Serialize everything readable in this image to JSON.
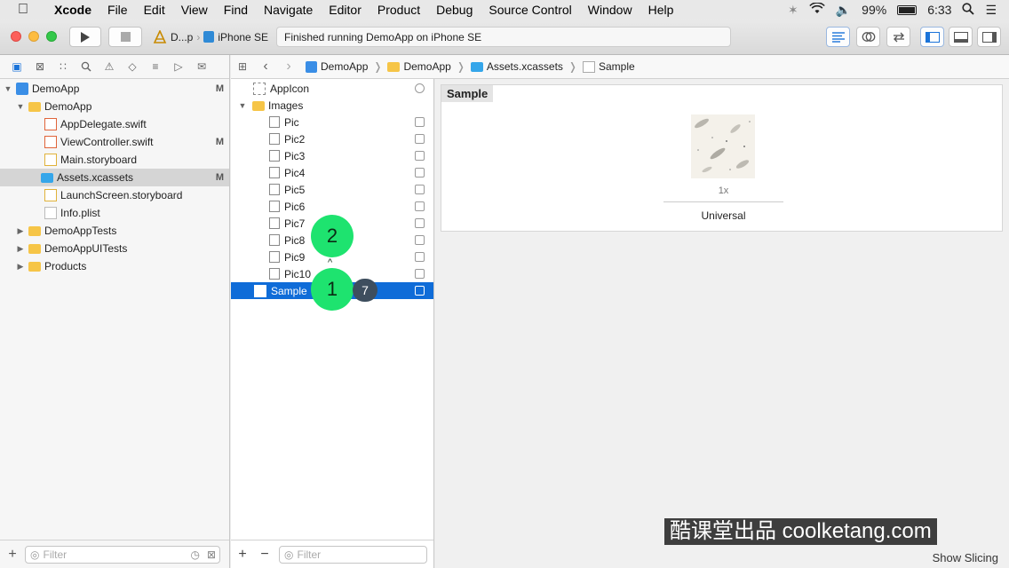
{
  "menubar": {
    "apple": "",
    "items": [
      "Xcode",
      "File",
      "Edit",
      "View",
      "Find",
      "Navigate",
      "Editor",
      "Product",
      "Debug",
      "Source Control",
      "Window",
      "Help"
    ],
    "battery": "99%",
    "time": "6:33"
  },
  "toolbar": {
    "scheme_target": "D...p",
    "scheme_device": "iPhone SE",
    "status_text": "Finished running DemoApp on iPhone SE"
  },
  "navigator": {
    "items": [
      {
        "label": "DemoApp",
        "badge": "M"
      },
      {
        "label": "DemoApp",
        "badge": ""
      },
      {
        "label": "AppDelegate.swift",
        "badge": ""
      },
      {
        "label": "ViewController.swift",
        "badge": "M"
      },
      {
        "label": "Main.storyboard",
        "badge": ""
      },
      {
        "label": "Assets.xcassets",
        "badge": "M"
      },
      {
        "label": "LaunchScreen.storyboard",
        "badge": ""
      },
      {
        "label": "Info.plist",
        "badge": ""
      },
      {
        "label": "DemoAppTests",
        "badge": ""
      },
      {
        "label": "DemoAppUITests",
        "badge": ""
      },
      {
        "label": "Products",
        "badge": ""
      }
    ],
    "filter_placeholder": "Filter"
  },
  "jumpbar": {
    "crumbs": [
      "DemoApp",
      "DemoApp",
      "Assets.xcassets",
      "Sample"
    ]
  },
  "assets": {
    "items": [
      "AppIcon",
      "Images",
      "Pic",
      "Pic2",
      "Pic3",
      "Pic4",
      "Pic5",
      "Pic6",
      "Pic7",
      "Pic8",
      "Pic9",
      "Pic10",
      "Sample"
    ],
    "filter_placeholder": "Filter",
    "add": "+",
    "remove": "−"
  },
  "editor": {
    "set_title": "Sample",
    "scale": "1x",
    "idiom": "Universal",
    "show_slicing": "Show Slicing"
  },
  "overlay": {
    "touch_1": "1",
    "touch_2": "2",
    "count": "7",
    "watermark": "酷课堂出品 coolketang.com"
  }
}
